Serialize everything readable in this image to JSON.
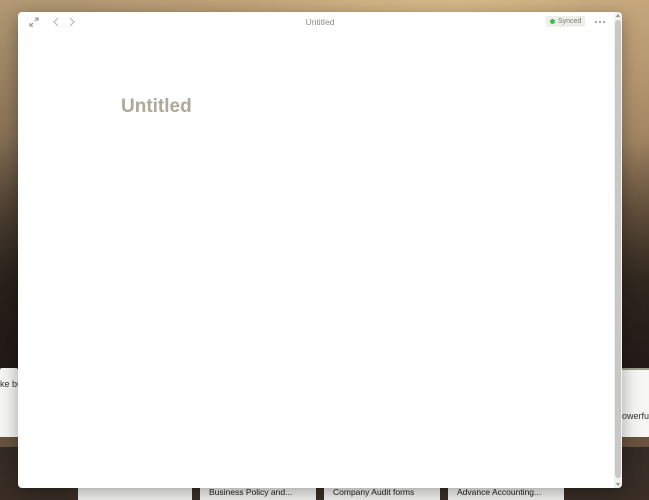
{
  "window": {
    "title": "Untitled",
    "sync_status": "Synced",
    "sync_color": "#3cbf4a"
  },
  "toolbar": {
    "icons": [
      "expand-icon",
      "back-arrow-icon",
      "forward-arrow-icon",
      "more-icon"
    ]
  },
  "page": {
    "title": "Untitled"
  },
  "background": {
    "left_card_text": "ke bu",
    "right_card_text": "owerful",
    "bottom_cards": [
      "Business Policy and...",
      "Company Audit forms",
      "Advance Accounting..."
    ]
  }
}
